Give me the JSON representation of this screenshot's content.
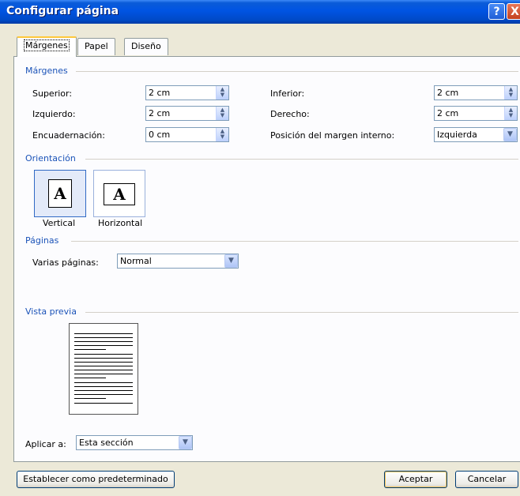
{
  "window": {
    "title": "Configurar página",
    "help_glyph": "?",
    "close_glyph": "X"
  },
  "tabs": [
    "Márgenes",
    "Papel",
    "Diseño"
  ],
  "margins": {
    "section": "Márgenes",
    "superior": {
      "label": "Superior:",
      "value": "2 cm"
    },
    "inferior": {
      "label": "Inferior:",
      "value": "2 cm"
    },
    "izquierdo": {
      "label": "Izquierdo:",
      "value": "2 cm"
    },
    "derecho": {
      "label": "Derecho:",
      "value": "2 cm"
    },
    "encuadernacion": {
      "label": "Encuadernación:",
      "value": "0 cm"
    },
    "posicion": {
      "label": "Posición del margen interno:",
      "value": "Izquierda"
    }
  },
  "orientation": {
    "section": "Orientación",
    "vertical": "Vertical",
    "horizontal": "Horizontal",
    "selected": "Vertical",
    "icon_letter": "A"
  },
  "pages": {
    "section": "Páginas",
    "label": "Varias páginas:",
    "value": "Normal"
  },
  "preview": {
    "section": "Vista previa"
  },
  "apply": {
    "label": "Aplicar a:",
    "value": "Esta sección"
  },
  "buttons": {
    "default": "Establecer como predeterminado",
    "ok": "Aceptar",
    "cancel": "Cancelar"
  },
  "colors": {
    "title_bar": "#0054e3",
    "section_text": "#1b53b8",
    "dialog_bg": "#ece9d8",
    "tab_highlight": "#ffc83c"
  }
}
